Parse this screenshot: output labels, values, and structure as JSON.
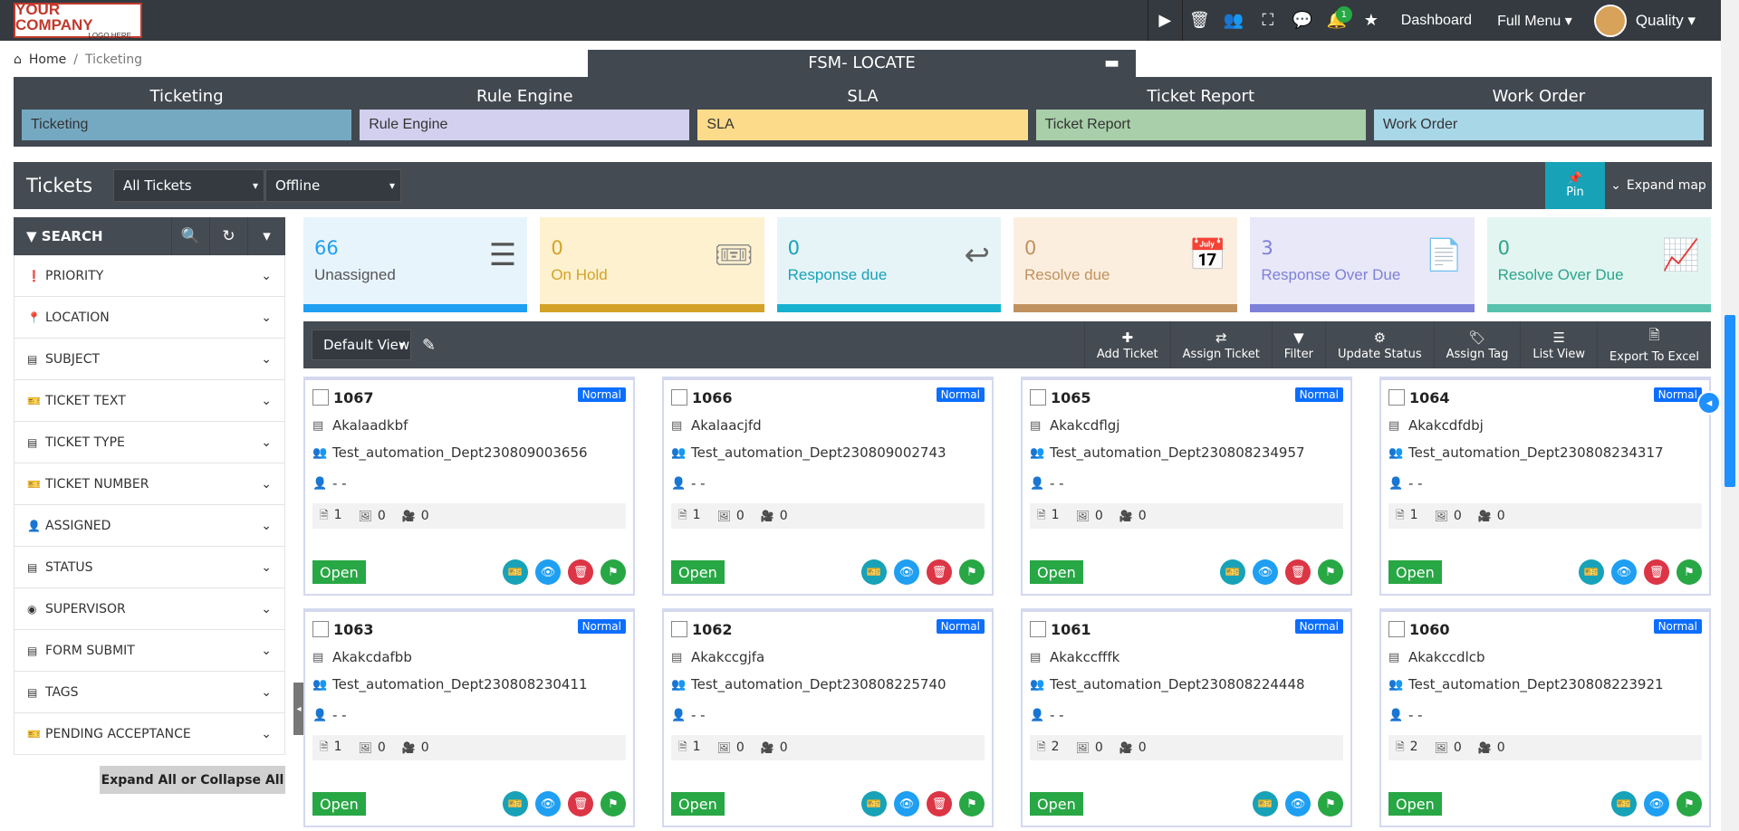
{
  "logo": {
    "line1": "YOUR COMPANY",
    "line2": "LOGO HERE"
  },
  "topbar": {
    "notif_count": "1",
    "dashboard": "Dashboard",
    "full_menu": "Full Menu",
    "user": "Quality"
  },
  "breadcrumb": {
    "home": "Home",
    "sep": "/",
    "current": "Ticketing"
  },
  "fsm_title": "FSM- LOCATE",
  "modules": [
    {
      "header": "Ticketing",
      "button": "Ticketing",
      "color": "#75a9c2"
    },
    {
      "header": "Rule Engine",
      "button": "Rule Engine",
      "color": "#d2d0ee"
    },
    {
      "header": "SLA",
      "button": "SLA",
      "color": "#fcdc8a"
    },
    {
      "header": "Ticket Report",
      "button": "Ticket Report",
      "color": "#a8cfa9"
    },
    {
      "header": "Work Order",
      "button": "Work Order",
      "color": "#a8d7e8"
    }
  ],
  "tickets_bar": {
    "title": "Tickets",
    "filter1": "All Tickets",
    "filter2": "Offline",
    "pin": "Pin",
    "expand_map": "Expand map"
  },
  "search": {
    "title": "SEARCH",
    "expand_all": "Expand All or Collapse All"
  },
  "filters": [
    {
      "label": "PRIORITY",
      "icon": "exclamation-circle-icon",
      "glyph": "❗"
    },
    {
      "label": "LOCATION",
      "icon": "map-pin-icon",
      "glyph": "📍"
    },
    {
      "label": "SUBJECT",
      "icon": "id-card-icon",
      "glyph": "▤"
    },
    {
      "label": "TICKET TEXT",
      "icon": "ticket-icon",
      "glyph": "🎫"
    },
    {
      "label": "TICKET TYPE",
      "icon": "list-icon",
      "glyph": "▤"
    },
    {
      "label": "TICKET NUMBER",
      "icon": "ticket-icon",
      "glyph": "🎫"
    },
    {
      "label": "ASSIGNED",
      "icon": "user-icon",
      "glyph": "👤"
    },
    {
      "label": "STATUS",
      "icon": "document-icon",
      "glyph": "▤"
    },
    {
      "label": "SUPERVISOR",
      "icon": "user-circle-icon",
      "glyph": "◉"
    },
    {
      "label": "FORM SUBMIT",
      "icon": "form-icon",
      "glyph": "▤"
    },
    {
      "label": "TAGS",
      "icon": "tags-icon",
      "glyph": "▤"
    },
    {
      "label": "PENDING ACCEPTANCE",
      "icon": "ticket-icon",
      "glyph": "🎫"
    }
  ],
  "stats": [
    {
      "value": "66",
      "label": "Unassigned",
      "icon": "list-icon",
      "glyph": "☰",
      "bg": "#e8f4fc",
      "bar": "#1e9ff2",
      "fg": "#1e9ff2",
      "icfg": "#555"
    },
    {
      "value": "0",
      "label": "On Hold",
      "icon": "ticket-icon",
      "glyph": "🎟",
      "bg": "#fdf1cf",
      "bar": "#d4a227",
      "fg": "#d4a227",
      "icfg": "#888"
    },
    {
      "value": "0",
      "label": "Response due",
      "icon": "reply-icon",
      "glyph": "↩",
      "bg": "#e6f4f8",
      "bar": "#17b1d0",
      "fg": "#17a2b8",
      "icfg": "#666"
    },
    {
      "value": "0",
      "label": "Resolve due",
      "icon": "calendar-check-icon",
      "glyph": "📅",
      "bg": "#fbeedf",
      "bar": "#c0925f",
      "fg": "#c0925f",
      "icfg": "#666"
    },
    {
      "value": "3",
      "label": "Response Over Due",
      "icon": "document-icon",
      "glyph": "📄",
      "bg": "#e8e8f8",
      "bar": "#7d80d8",
      "fg": "#7d80d8",
      "icfg": "#777"
    },
    {
      "value": "0",
      "label": "Resolve Over Due",
      "icon": "chart-line-icon",
      "glyph": "📈",
      "bg": "#e3f5f1",
      "bar": "#57c2ad",
      "fg": "#2aa58b",
      "icfg": "#666"
    }
  ],
  "toolbar": {
    "default_view": "Default View",
    "buttons": [
      {
        "label": "Add Ticket",
        "icon": "plus-icon",
        "glyph": "✚"
      },
      {
        "label": "Assign Ticket",
        "icon": "exchange-icon",
        "glyph": "⇄"
      },
      {
        "label": "Filter",
        "icon": "filter-icon",
        "glyph": "▼"
      },
      {
        "label": "Update Status",
        "icon": "gear-icon",
        "glyph": "⚙"
      },
      {
        "label": "Assign Tag",
        "icon": "tag-icon",
        "glyph": "🏷"
      },
      {
        "label": "List View",
        "icon": "list-view-icon",
        "glyph": "☰"
      },
      {
        "label": "Export To Excel",
        "icon": "excel-icon",
        "glyph": "🗎"
      }
    ]
  },
  "tickets": [
    {
      "id": "1067",
      "priority": "Normal",
      "subject": "Akalaadkbf",
      "dept": "Test_automation_Dept230809003656",
      "assignee": "- -",
      "docs": "1",
      "images": "0",
      "videos": "0",
      "status": "Open",
      "delete": true
    },
    {
      "id": "1066",
      "priority": "Normal",
      "subject": "Akalaacjfd",
      "dept": "Test_automation_Dept230809002743",
      "assignee": "- -",
      "docs": "1",
      "images": "0",
      "videos": "0",
      "status": "Open",
      "delete": true
    },
    {
      "id": "1065",
      "priority": "Normal",
      "subject": "Akakcdflgj",
      "dept": "Test_automation_Dept230808234957",
      "assignee": "- -",
      "docs": "1",
      "images": "0",
      "videos": "0",
      "status": "Open",
      "delete": true
    },
    {
      "id": "1064",
      "priority": "Normal",
      "subject": "Akakcdfdbj",
      "dept": "Test_automation_Dept230808234317",
      "assignee": "- -",
      "docs": "1",
      "images": "0",
      "videos": "0",
      "status": "Open",
      "delete": true
    },
    {
      "id": "1063",
      "priority": "Normal",
      "subject": "Akakcdafbb",
      "dept": "Test_automation_Dept230808230411",
      "assignee": "- -",
      "docs": "1",
      "images": "0",
      "videos": "0",
      "status": "Open",
      "delete": true
    },
    {
      "id": "1062",
      "priority": "Normal",
      "subject": "Akakccgjfa",
      "dept": "Test_automation_Dept230808225740",
      "assignee": "- -",
      "docs": "1",
      "images": "0",
      "videos": "0",
      "status": "Open",
      "delete": true
    },
    {
      "id": "1061",
      "priority": "Normal",
      "subject": "Akakccfffk",
      "dept": "Test_automation_Dept230808224448",
      "assignee": "- -",
      "docs": "2",
      "images": "0",
      "videos": "0",
      "status": "Open",
      "delete": false
    },
    {
      "id": "1060",
      "priority": "Normal",
      "subject": "Akakccdlcb",
      "dept": "Test_automation_Dept230808223921",
      "assignee": "- -",
      "docs": "2",
      "images": "0",
      "videos": "0",
      "status": "Open",
      "delete": false
    }
  ]
}
